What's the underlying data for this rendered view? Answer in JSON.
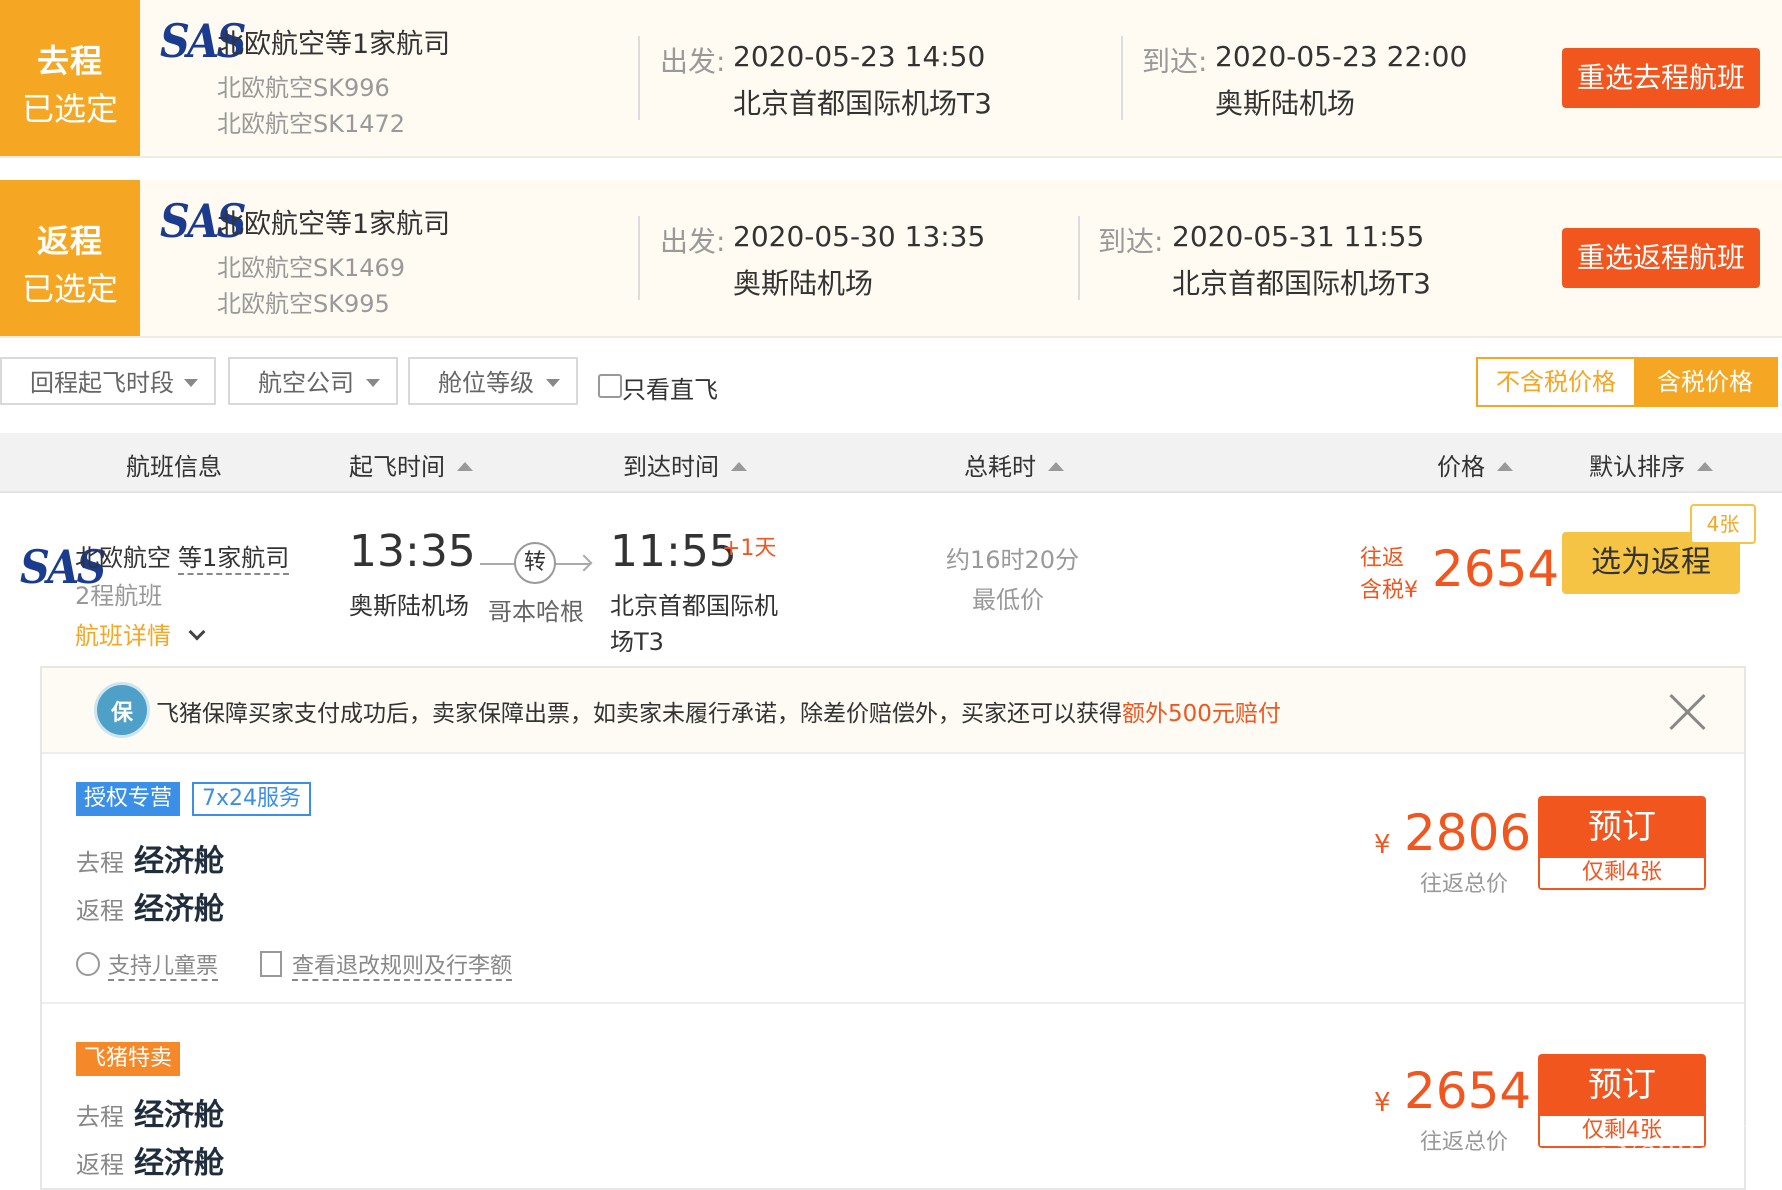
{
  "outbound": {
    "tag_line1": "去程",
    "tag_line2": "已选定",
    "logo": "SAS",
    "airline": "北欧航空等1家航司",
    "flights": [
      "北欧航空SK996",
      "北欧航空SK1472"
    ],
    "depart_label": "出发:",
    "depart_time": "2020-05-23 14:50",
    "depart_airport": "北京首都国际机场T3",
    "arrive_label": "到达:",
    "arrive_time": "2020-05-23 22:00",
    "arrive_airport": "奥斯陆机场",
    "reselect_label": "重选去程航班"
  },
  "return": {
    "tag_line1": "返程",
    "tag_line2": "已选定",
    "logo": "SAS",
    "airline": "北欧航空等1家航司",
    "flights": [
      "北欧航空SK1469",
      "北欧航空SK995"
    ],
    "depart_label": "出发:",
    "depart_time": "2020-05-30 13:35",
    "depart_airport": "奥斯陆机场",
    "arrive_label": "到达:",
    "arrive_time": "2020-05-31 11:55",
    "arrive_airport": "北京首都国际机场T3",
    "reselect_label": "重选返程航班"
  },
  "filters": {
    "time_period": "回程起飞时段",
    "airline": "航空公司",
    "cabin": "舱位等级",
    "direct_only": "只看直飞",
    "price_excl_tax": "不含税价格",
    "price_incl_tax": "含税价格"
  },
  "columns": {
    "flight_info": "航班信息",
    "depart_time": "起飞时间",
    "arrive_time": "到达时间",
    "duration": "总耗时",
    "price": "价格",
    "default_sort": "默认排序"
  },
  "result": {
    "logo": "SAS",
    "airline": "北欧航空",
    "airline_more": "等1家航司",
    "segments": "2程航班",
    "details_link": "航班详情",
    "depart_time": "13:35",
    "depart_airport": "奥斯陆机场",
    "transfer_label": "转",
    "transfer_city": "哥本哈根",
    "arrive_time": "11:55",
    "arrive_plus": "+1天",
    "arrive_airport_line1": "北京首都国际机",
    "arrive_airport_line2": "场T3",
    "duration": "约16时20分",
    "lowest": "最低价",
    "price_label1": "往返",
    "price_label2": "含税",
    "currency": "¥",
    "price": "2654",
    "tickets_left": "4张",
    "select_label": "选为返程"
  },
  "notice": {
    "badge": "保",
    "text": "飞猪保障买家支付成功后，卖家保障出票，如卖家未履行承诺，除差价赔偿外，买家还可以获得",
    "highlight": "额外500元赔付"
  },
  "offers": [
    {
      "tag1": "授权专营",
      "tag2": "7x24服务",
      "out_label": "去程",
      "out_cabin": "经济舱",
      "ret_label": "返程",
      "ret_cabin": "经济舱",
      "child_ticket": "支持儿童票",
      "rules": "查看退改规则及行李额",
      "currency": "¥",
      "price": "2806",
      "price_note": "往返总价",
      "book": "预订",
      "remaining": "仅剩4张"
    },
    {
      "tag1": "飞猪特卖",
      "out_label": "去程",
      "out_cabin": "经济舱",
      "ret_label": "返程",
      "ret_cabin": "经济舱",
      "currency": "¥",
      "price": "2654",
      "price_note": "往返总价",
      "book": "预订",
      "remaining": "仅剩4张"
    }
  ],
  "watermark": "ohYeng.net",
  "colors": {
    "tag_yellow": "#f5a623",
    "accent_orange": "#f2561f",
    "logo_blue": "#1a3b8e",
    "select_yellow": "#f5c445"
  }
}
